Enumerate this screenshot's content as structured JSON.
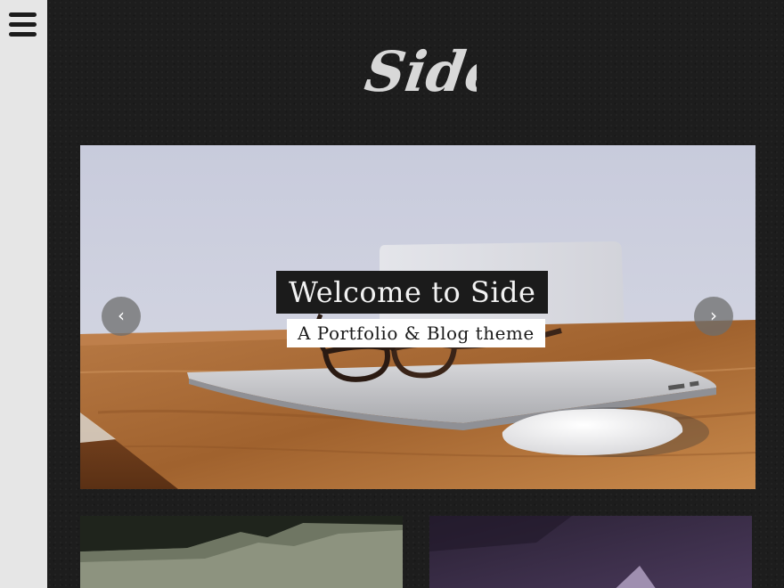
{
  "sidebar": {
    "menu_icon": "hamburger-menu-icon"
  },
  "header": {
    "logo_text": "Side"
  },
  "slider": {
    "title": "Welcome to Side",
    "subtitle": "A Portfolio & Blog theme",
    "prev_icon": "chevron-left-icon",
    "prev_glyph": "‹",
    "next_icon": "chevron-right-icon",
    "next_glyph": "›"
  },
  "colors": {
    "sidebar_bg": "#e6e6e6",
    "main_bg": "#1d1d1d",
    "title_bg": "#1b1b1b",
    "subtitle_bg": "#ffffff"
  }
}
